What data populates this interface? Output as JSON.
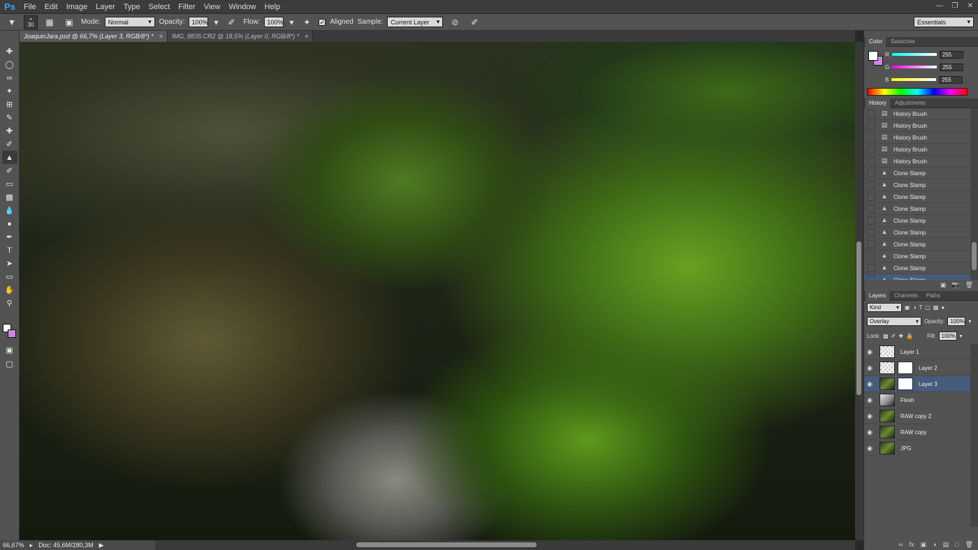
{
  "menu": {
    "logo": "Ps",
    "items": [
      "File",
      "Edit",
      "Image",
      "Layer",
      "Type",
      "Select",
      "Filter",
      "View",
      "Window",
      "Help"
    ]
  },
  "options": {
    "brush_size": "30",
    "mode_label": "Mode:",
    "mode_value": "Normal",
    "opacity_label": "Opacity:",
    "opacity_value": "100%",
    "flow_label": "Flow:",
    "flow_value": "100%",
    "aligned_label": "Aligned",
    "sample_label": "Sample:",
    "sample_value": "Current Layer",
    "workspace": "Essentials"
  },
  "tabs": [
    {
      "label": "JoaquinJara.psd @ 66,7% (Layer 3, RGB/8*) *",
      "active": true
    },
    {
      "label": "IMG_8835.CR2 @ 18,5% (Layer 0, RGB/8*) *",
      "active": false
    }
  ],
  "status": {
    "zoom": "66,67%",
    "doc": "Doc: 45,6M/280,3M"
  },
  "color_panel": {
    "tabs": [
      "Color",
      "Swatches"
    ],
    "r_label": "R",
    "r_value": "255",
    "g_label": "G",
    "g_value": "255",
    "b_label": "B",
    "b_value": "255",
    "foreground": "#ffffff",
    "background": "#cc88dd"
  },
  "history_panel": {
    "tabs": [
      "History",
      "Adjustments"
    ],
    "items": [
      "History Brush",
      "History Brush",
      "History Brush",
      "History Brush",
      "History Brush",
      "Clone Stamp",
      "Clone Stamp",
      "Clone Stamp",
      "Clone Stamp",
      "Clone Stamp",
      "Clone Stamp",
      "Clone Stamp",
      "Clone Stamp",
      "Clone Stamp",
      "Clone Stamp"
    ]
  },
  "layers_panel": {
    "tabs": [
      "Layers",
      "Channels",
      "Paths"
    ],
    "kind_label": "Kind",
    "blend_mode": "Overlay",
    "opacity_label": "Opacity:",
    "opacity_value": "100%",
    "lock_label": "Lock:",
    "fill_label": "Fill:",
    "fill_value": "100%",
    "layers": [
      {
        "name": "Layer 1"
      },
      {
        "name": "Layer 2"
      },
      {
        "name": "Layer 3"
      },
      {
        "name": "Flesh"
      },
      {
        "name": "RAW copy 2"
      },
      {
        "name": "RAW copy"
      },
      {
        "name": "JPG"
      }
    ]
  },
  "accent_color": "#31a8ff",
  "selection_color": "#475b7a"
}
